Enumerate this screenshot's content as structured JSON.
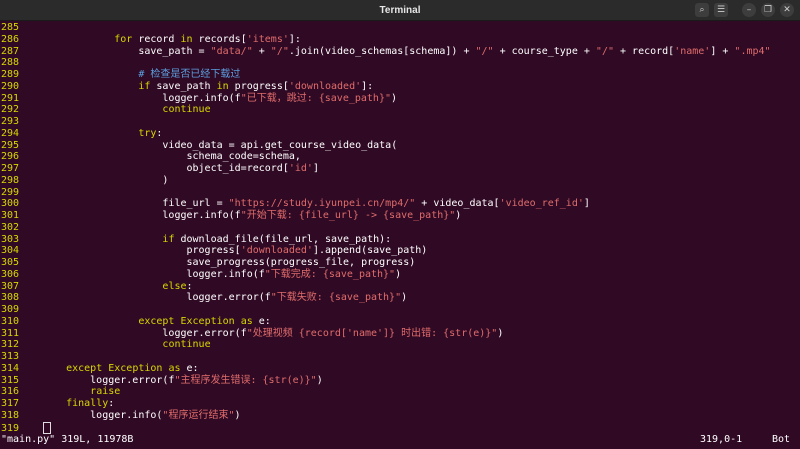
{
  "window": {
    "title": "Terminal"
  },
  "titlebar_buttons": [
    {
      "name": "search-icon",
      "glyph": "⌕"
    },
    {
      "name": "menu-icon",
      "glyph": "☰"
    },
    {
      "name": "minimize-icon",
      "glyph": "–"
    },
    {
      "name": "maximize-icon",
      "glyph": "❐"
    },
    {
      "name": "close-icon",
      "glyph": "✕"
    }
  ],
  "code_lines": [
    {
      "num": "285",
      "text": ""
    },
    {
      "num": "286",
      "text": "            for record in records['items']:"
    },
    {
      "num": "287",
      "text": "                save_path = \"data/\" + \"/\".join(video_schemas[schema]) + \"/\" + course_type + \"/\" + record['name'] + \".mp4\""
    },
    {
      "num": "288",
      "text": ""
    },
    {
      "num": "289",
      "text": "                # 检查是否已经下载过"
    },
    {
      "num": "290",
      "text": "                if save_path in progress['downloaded']:"
    },
    {
      "num": "291",
      "text": "                    logger.info(f\"已下载，跳过: {save_path}\")"
    },
    {
      "num": "292",
      "text": "                    continue"
    },
    {
      "num": "293",
      "text": ""
    },
    {
      "num": "294",
      "text": "                try:"
    },
    {
      "num": "295",
      "text": "                    video_data = api.get_course_video_data("
    },
    {
      "num": "296",
      "text": "                        schema_code=schema,"
    },
    {
      "num": "297",
      "text": "                        object_id=record['id']"
    },
    {
      "num": "298",
      "text": "                    )"
    },
    {
      "num": "299",
      "text": ""
    },
    {
      "num": "300",
      "text": "                    file_url = \"https://study.iyunpei.cn/mp4/\" + video_data['video_ref_id']"
    },
    {
      "num": "301",
      "text": "                    logger.info(f\"开始下载: {file_url} -> {save_path}\")"
    },
    {
      "num": "302",
      "text": ""
    },
    {
      "num": "303",
      "text": "                    if download_file(file_url, save_path):"
    },
    {
      "num": "304",
      "text": "                        progress['downloaded'].append(save_path)"
    },
    {
      "num": "305",
      "text": "                        save_progress(progress_file, progress)"
    },
    {
      "num": "306",
      "text": "                        logger.info(f\"下载完成: {save_path}\")"
    },
    {
      "num": "307",
      "text": "                    else:"
    },
    {
      "num": "308",
      "text": "                        logger.error(f\"下载失败: {save_path}\")"
    },
    {
      "num": "309",
      "text": ""
    },
    {
      "num": "310",
      "text": "                except Exception as e:"
    },
    {
      "num": "311",
      "text": "                    logger.error(f\"处理视频 {record['name']} 时出错: {str(e)}\")"
    },
    {
      "num": "312",
      "text": "                    continue"
    },
    {
      "num": "313",
      "text": ""
    },
    {
      "num": "314",
      "text": "    except Exception as e:"
    },
    {
      "num": "315",
      "text": "        logger.error(f\"主程序发生错误: {str(e)}\")"
    },
    {
      "num": "316",
      "text": "        raise"
    },
    {
      "num": "317",
      "text": "    finally:"
    },
    {
      "num": "318",
      "text": "        logger.info(\"程序运行结束\")"
    },
    {
      "num": "319",
      "text": ""
    }
  ],
  "status": {
    "file_info": "\"main.py\" 319L, 11978B",
    "position": "319,0-1",
    "scroll": "Bot"
  },
  "colors": {
    "background": "#300a24",
    "line_number": "#d7d700",
    "keyword": "#d7d700",
    "string": "#e06c6c",
    "comment": "#5c9fe0"
  }
}
